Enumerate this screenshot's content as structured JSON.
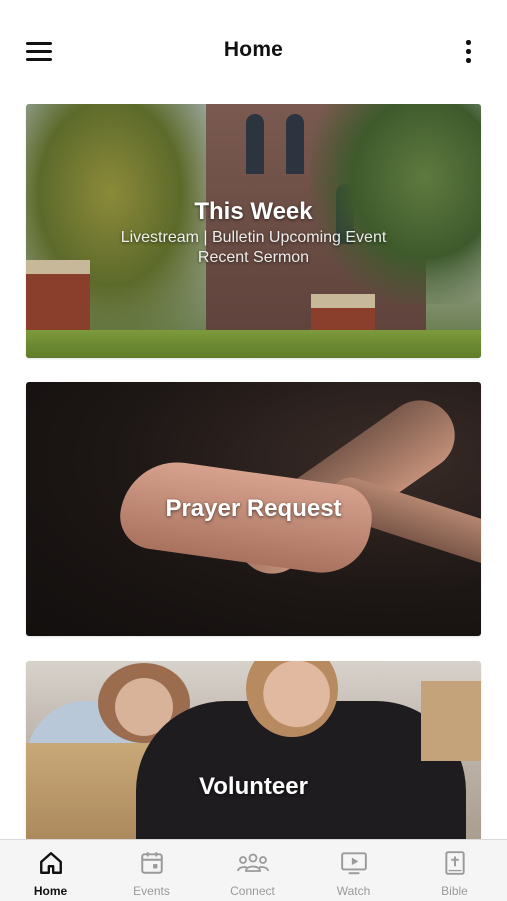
{
  "header": {
    "title": "Home",
    "menu_icon": "hamburger-menu-icon",
    "more_icon": "more-vertical-icon"
  },
  "cards": [
    {
      "title": "This Week",
      "subtitle_line1": "Livestream | Bulletin Upcoming Event",
      "subtitle_line2": "Recent Sermon"
    },
    {
      "title": "Prayer Request"
    },
    {
      "title": "Volunteer"
    }
  ],
  "tabbar": {
    "active": "Home",
    "items": [
      {
        "label": "Home",
        "icon": "home-icon"
      },
      {
        "label": "Events",
        "icon": "calendar-icon"
      },
      {
        "label": "Connect",
        "icon": "people-icon"
      },
      {
        "label": "Watch",
        "icon": "tv-play-icon"
      },
      {
        "label": "Bible",
        "icon": "bible-cross-icon"
      }
    ],
    "active_color": "#111111",
    "inactive_color": "#9a9a9a"
  }
}
